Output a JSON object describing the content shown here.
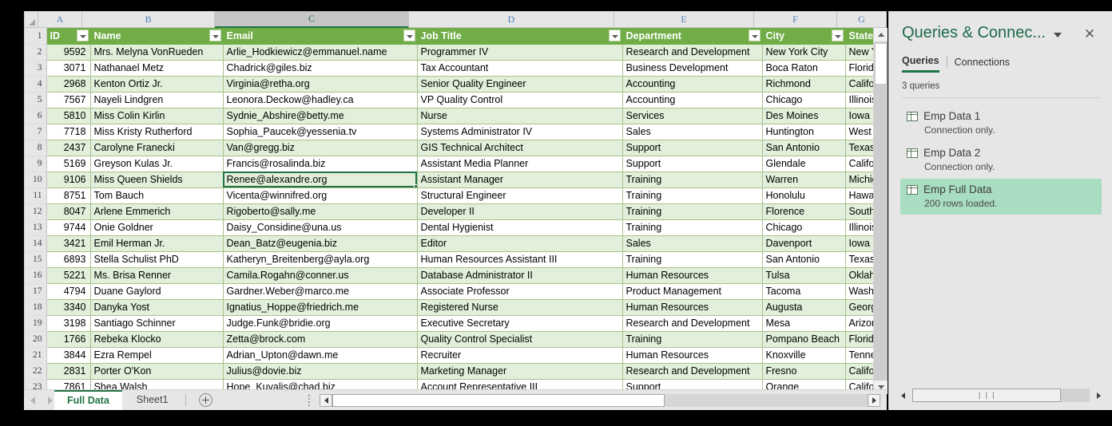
{
  "grid": {
    "column_letters": [
      "A",
      "B",
      "C",
      "D",
      "E",
      "F",
      "G"
    ],
    "selected_column": "C",
    "active_cell": "C10",
    "headers": [
      "ID",
      "Name",
      "Email",
      "Job Title",
      "Department",
      "City",
      "State"
    ],
    "row_numbers": [
      "1",
      "2",
      "3",
      "4",
      "5",
      "6",
      "7",
      "8",
      "9",
      "10",
      "11",
      "12",
      "13",
      "14",
      "15",
      "16",
      "17",
      "18",
      "19",
      "20",
      "21",
      "22",
      "23"
    ],
    "rows": [
      {
        "n": "2",
        "id": "9592",
        "name": "Mrs. Melyna VonRueden",
        "email": "Arlie_Hodkiewicz@emmanuel.name",
        "job": "Programmer IV",
        "dept": "Research and Development",
        "city": "New York City",
        "state": "New York"
      },
      {
        "n": "3",
        "id": "3071",
        "name": "Nathanael Metz",
        "email": "Chadrick@giles.biz",
        "job": "Tax Accountant",
        "dept": "Business Development",
        "city": "Boca Raton",
        "state": "Florida"
      },
      {
        "n": "4",
        "id": "2968",
        "name": "Kenton Ortiz Jr.",
        "email": "Virginia@retha.org",
        "job": "Senior Quality Engineer",
        "dept": "Accounting",
        "city": "Richmond",
        "state": "California"
      },
      {
        "n": "5",
        "id": "7567",
        "name": "Nayeli Lindgren",
        "email": "Leonora.Deckow@hadley.ca",
        "job": "VP Quality Control",
        "dept": "Accounting",
        "city": "Chicago",
        "state": "Illinois"
      },
      {
        "n": "6",
        "id": "5810",
        "name": "Miss Colin Kirlin",
        "email": "Sydnie_Abshire@betty.me",
        "job": "Nurse",
        "dept": "Services",
        "city": "Des Moines",
        "state": "Iowa"
      },
      {
        "n": "7",
        "id": "7718",
        "name": "Miss Kristy Rutherford",
        "email": "Sophia_Paucek@yessenia.tv",
        "job": "Systems Administrator IV",
        "dept": "Sales",
        "city": "Huntington",
        "state": "West Virginia"
      },
      {
        "n": "8",
        "id": "2437",
        "name": "Carolyne Franecki",
        "email": "Van@gregg.biz",
        "job": "GIS Technical Architect",
        "dept": "Support",
        "city": "San Antonio",
        "state": "Texas"
      },
      {
        "n": "9",
        "id": "5169",
        "name": "Greyson Kulas Jr.",
        "email": "Francis@rosalinda.biz",
        "job": "Assistant Media Planner",
        "dept": "Support",
        "city": "Glendale",
        "state": "California"
      },
      {
        "n": "10",
        "id": "9106",
        "name": "Miss Queen Shields",
        "email": "Renee@alexandre.org",
        "job": "Assistant Manager",
        "dept": "Training",
        "city": "Warren",
        "state": "Michigan"
      },
      {
        "n": "11",
        "id": "8751",
        "name": "Tom Bauch",
        "email": "Vicenta@winnifred.org",
        "job": "Structural Engineer",
        "dept": "Training",
        "city": "Honolulu",
        "state": "Hawaii"
      },
      {
        "n": "12",
        "id": "8047",
        "name": "Arlene Emmerich",
        "email": "Rigoberto@sally.me",
        "job": "Developer II",
        "dept": "Training",
        "city": "Florence",
        "state": "South Carolina"
      },
      {
        "n": "13",
        "id": "9744",
        "name": "Onie Goldner",
        "email": "Daisy_Considine@una.us",
        "job": "Dental Hygienist",
        "dept": "Training",
        "city": "Chicago",
        "state": "Illinois"
      },
      {
        "n": "14",
        "id": "3421",
        "name": "Emil Herman Jr.",
        "email": "Dean_Batz@eugenia.biz",
        "job": "Editor",
        "dept": "Sales",
        "city": "Davenport",
        "state": "Iowa"
      },
      {
        "n": "15",
        "id": "6893",
        "name": "Stella Schulist PhD",
        "email": "Katheryn_Breitenberg@ayla.org",
        "job": "Human Resources Assistant III",
        "dept": "Training",
        "city": "San Antonio",
        "state": "Texas"
      },
      {
        "n": "16",
        "id": "5221",
        "name": "Ms. Brisa Renner",
        "email": "Camila.Rogahn@conner.us",
        "job": "Database Administrator II",
        "dept": "Human Resources",
        "city": "Tulsa",
        "state": "Oklahoma"
      },
      {
        "n": "17",
        "id": "4794",
        "name": "Duane Gaylord",
        "email": "Gardner.Weber@marco.me",
        "job": "Associate Professor",
        "dept": "Product Management",
        "city": "Tacoma",
        "state": "Washington"
      },
      {
        "n": "18",
        "id": "3340",
        "name": "Danyka Yost",
        "email": "Ignatius_Hoppe@friedrich.me",
        "job": "Registered Nurse",
        "dept": "Human Resources",
        "city": "Augusta",
        "state": "Georgia"
      },
      {
        "n": "19",
        "id": "3198",
        "name": "Santiago Schinner",
        "email": "Judge.Funk@bridie.org",
        "job": "Executive Secretary",
        "dept": "Research and Development",
        "city": "Mesa",
        "state": "Arizona"
      },
      {
        "n": "20",
        "id": "1766",
        "name": "Rebeka Klocko",
        "email": "Zetta@brock.com",
        "job": "Quality Control Specialist",
        "dept": "Training",
        "city": "Pompano Beach",
        "state": "Florida"
      },
      {
        "n": "21",
        "id": "3844",
        "name": "Ezra Rempel",
        "email": "Adrian_Upton@dawn.me",
        "job": "Recruiter",
        "dept": "Human Resources",
        "city": "Knoxville",
        "state": "Tennessee"
      },
      {
        "n": "22",
        "id": "2831",
        "name": "Porter O'Kon",
        "email": "Julius@dovie.biz",
        "job": "Marketing Manager",
        "dept": "Research and Development",
        "city": "Fresno",
        "state": "California"
      },
      {
        "n": "23",
        "id": "7861",
        "name": "Shea Walsh",
        "email": "Hope_Kuvalis@chad.biz",
        "job": "Account Representative III",
        "dept": "Support",
        "city": "Orange",
        "state": "California"
      }
    ]
  },
  "tabbar": {
    "sheets": [
      {
        "label": "Full Data",
        "active": true
      },
      {
        "label": "Sheet1",
        "active": false
      }
    ],
    "add_sheet_label": "+"
  },
  "queries_pane": {
    "title": "Queries & Connec...",
    "close_label": "✕",
    "tabs": [
      {
        "label": "Queries",
        "active": true
      },
      {
        "label": "Connections",
        "active": false
      }
    ],
    "count_label": "3 queries",
    "items": [
      {
        "name": "Emp Data 1",
        "status": "Connection only.",
        "selected": false
      },
      {
        "name": "Emp Data 2",
        "status": "Connection only.",
        "selected": false
      },
      {
        "name": "Emp Full Data",
        "status": "200 rows loaded.",
        "selected": true
      }
    ],
    "scroll_grip": "❘❘❘"
  },
  "colors": {
    "table_header_green": "#70ad47",
    "band_green": "#e2efda",
    "accent_green": "#217346",
    "selection_green": "#a9ddc2",
    "title_green": "#1f6b4a"
  }
}
